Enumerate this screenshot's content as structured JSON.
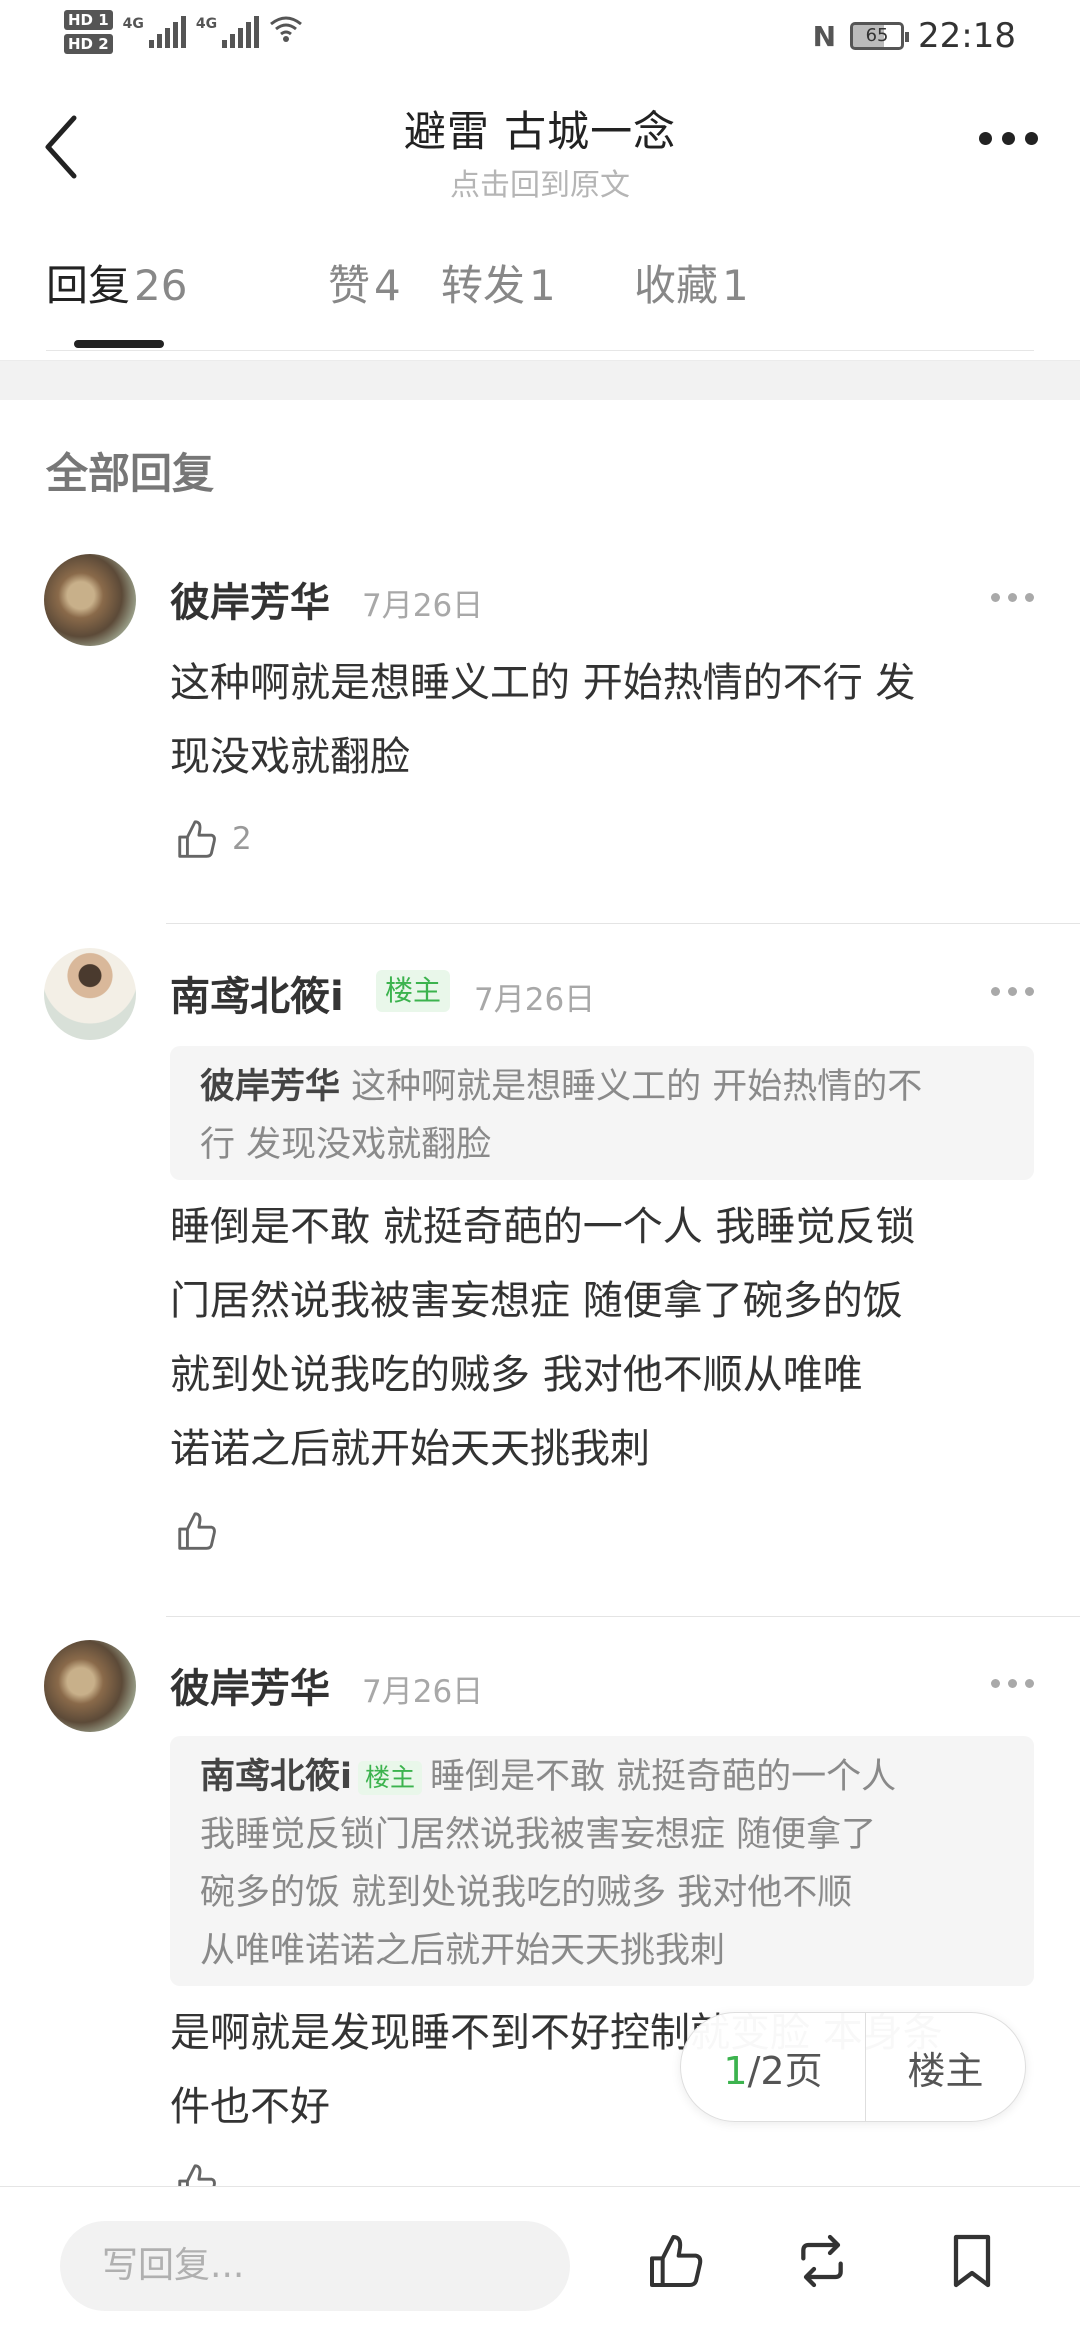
{
  "status_bar": {
    "hd1": "HD 1",
    "hd2": "HD 2",
    "net1": "4G",
    "net2": "4G",
    "nfc": "N",
    "battery": "65",
    "time": "22:18"
  },
  "header": {
    "title": "避雷   古城一念",
    "subtitle": "点击回到原文"
  },
  "tabs": [
    {
      "label": "回复",
      "count": "26",
      "active": true
    },
    {
      "label": "赞",
      "count": "4"
    },
    {
      "label": "转发",
      "count": "1"
    },
    {
      "label": "收藏",
      "count": "1"
    }
  ],
  "section_title": "全部回复",
  "comments": [
    {
      "user": "彼岸芳华",
      "date": "7月26日",
      "text_lines": [
        "这种啊就是想睡义工的 开始热情的不行 发",
        "现没戏就翻脸"
      ],
      "likes": "2"
    },
    {
      "user": "南鸢北筱i",
      "badge": "楼主",
      "date": "7月26日",
      "quote_user": "彼岸芳华",
      "quote_lines": [
        "这种啊就是想睡义工的 开始热情的不",
        "行 发现没戏就翻脸"
      ],
      "text_lines": [
        "睡倒是不敢  就挺奇葩的一个人  我睡觉反锁",
        "门居然说我被害妄想症    随便拿了碗多的饭",
        "就到处说我吃的贼多      我对他不顺从唯唯",
        "诺诺之后就开始天天挑我刺"
      ]
    },
    {
      "user": "彼岸芳华",
      "date": "7月26日",
      "quote_user": "南鸢北筱i",
      "quote_badge": "楼主",
      "quote_lines": [
        "睡倒是不敢  就挺奇葩的一个人",
        "我睡觉反锁门居然说我被害妄想症    随便拿了",
        "碗多的饭  就到处说我吃的贼多      我对他不顺",
        "从唯唯诺诺之后就开始天天挑我刺"
      ],
      "text_lines": [
        "是啊就是发现睡不到不好控制就变脸 本身条",
        "件也不好"
      ]
    }
  ],
  "pager": {
    "current": "1",
    "rest": "/2页",
    "louzhu_label": "楼主"
  },
  "bottom_bar": {
    "reply_placeholder": "写回复..."
  }
}
